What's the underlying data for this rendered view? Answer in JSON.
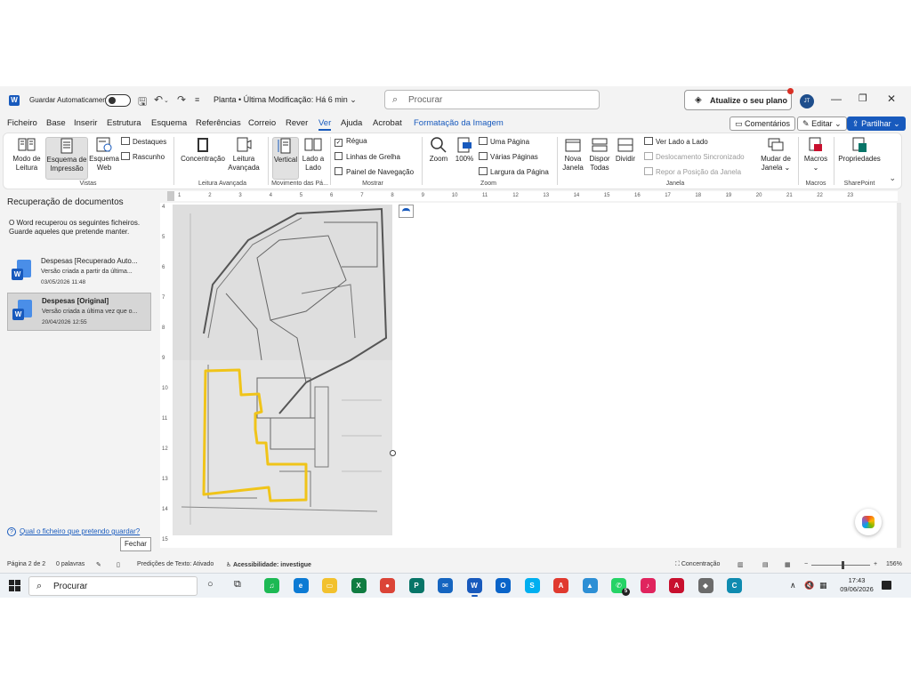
{
  "titlebar": {
    "autosave_label": "Guardar Automaticamente",
    "doc_title": "Planta • Última Modificação: Há 6 min",
    "search_placeholder": "Procurar",
    "upgrade_label": "Atualize o seu plano",
    "user_initials": "JT"
  },
  "menu": {
    "tabs": [
      "Ficheiro",
      "Base",
      "Inserir",
      "Estrutura",
      "Esquema",
      "Referências",
      "Correio",
      "Rever",
      "Ver",
      "Ajuda",
      "Acrobat",
      "Formatação da Imagem"
    ],
    "active_tab": "Ver",
    "comments_label": "Comentários",
    "edit_label": "Editar",
    "share_label": "Partilhar"
  },
  "ribbon": {
    "views": {
      "read_mode": "Modo de Leitura",
      "print_layout": "Esquema de Impressão",
      "web_layout": "Esquema Web",
      "outline": "Destaques",
      "draft": "Rascunho",
      "group_label": "Vistas"
    },
    "immersive": {
      "focus": "Concentração",
      "immersive_reader": "Leitura Avançada",
      "group_label": "Leitura Avançada"
    },
    "page_movement": {
      "vertical": "Vertical",
      "side_to_side": "Lado a Lado",
      "group_label": "Movimento das Pá..."
    },
    "show": {
      "ruler": "Régua",
      "gridlines": "Linhas de Grelha",
      "nav_pane": "Painel de Navegação",
      "ruler_checked": true,
      "gridlines_checked": false,
      "nav_pane_checked": false,
      "group_label": "Mostrar"
    },
    "zoom": {
      "zoom": "Zoom",
      "hundred": "100%",
      "one_page": "Uma Página",
      "multiple_pages": "Várias Páginas",
      "page_width": "Largura da Página",
      "group_label": "Zoom"
    },
    "window": {
      "new_window": "Nova Janela",
      "arrange_all": "Dispor Todas",
      "split": "Dividir",
      "side_by_side": "Ver Lado a Lado",
      "sync_scroll": "Deslocamento Sincronizado",
      "reset_position": "Repor a Posição da Janela",
      "switch_windows": "Mudar de Janela",
      "group_label": "Janela"
    },
    "macros": {
      "label": "Macros",
      "group_label": "Macros"
    },
    "sharepoint": {
      "label": "Propriedades",
      "group_label": "SharePoint"
    }
  },
  "recovery": {
    "title": "Recuperação de documentos",
    "message": "O Word recuperou os seguintes ficheiros. Guarde aqueles que pretende manter.",
    "items": [
      {
        "name": "Despesas  [Recuperado Auto...",
        "desc": "Versão criada a partir da última...",
        "date": "03/05/2026 11:48",
        "selected": false
      },
      {
        "name": "Despesas  [Original]",
        "desc": "Versão criada a última vez que o...",
        "date": "20/04/2026 12:55",
        "selected": true
      }
    ],
    "help_link": "Qual o ficheiro que pretendo guardar?",
    "close_label": "Fechar"
  },
  "ruler": {
    "h_ticks": [
      "1",
      "2",
      "3",
      "4",
      "5",
      "6",
      "7",
      "8",
      "9",
      "10",
      "11",
      "12",
      "13",
      "14",
      "15",
      "16",
      "17",
      "18",
      "19",
      "20",
      "21",
      "22",
      "23"
    ],
    "v_ticks": [
      "4",
      "5",
      "6",
      "7",
      "8",
      "9",
      "10",
      "11",
      "12",
      "13",
      "14",
      "15"
    ]
  },
  "status": {
    "page": "Página 2 de 2",
    "words": "0 palavras",
    "predictions": "Predições de Texto: Ativado",
    "accessibility": "Acessibilidade: investigue",
    "focus": "Concentração",
    "zoom_pct": "156%"
  },
  "taskbar": {
    "search_label": "Procurar",
    "apps": [
      {
        "name": "spotify-icon",
        "color": "#1db954",
        "glyph": "♫"
      },
      {
        "name": "edge-icon",
        "color": "#0c7bd4",
        "glyph": "e"
      },
      {
        "name": "file-explorer-icon",
        "color": "#f2c12e",
        "glyph": "▭"
      },
      {
        "name": "excel-icon",
        "color": "#107c41",
        "glyph": "X"
      },
      {
        "name": "chrome-icon",
        "color": "#db4437",
        "glyph": "●"
      },
      {
        "name": "publisher-icon",
        "color": "#077568",
        "glyph": "P"
      },
      {
        "name": "outlook-mail-icon",
        "color": "#1565c0",
        "glyph": "✉"
      },
      {
        "name": "word-icon",
        "color": "#185abd",
        "glyph": "W"
      },
      {
        "name": "outlook-icon",
        "color": "#0a64c9",
        "glyph": "O"
      },
      {
        "name": "skype-icon",
        "color": "#00aff0",
        "glyph": "S"
      },
      {
        "name": "acrobat-reader-icon",
        "color": "#e03a2f",
        "glyph": "A"
      },
      {
        "name": "photos-icon",
        "color": "#2d8fd5",
        "glyph": "▲"
      },
      {
        "name": "whatsapp-icon",
        "color": "#25d366",
        "glyph": "✆"
      },
      {
        "name": "tiktok-icon",
        "color": "#e0245e",
        "glyph": "♪"
      },
      {
        "name": "acrobat-icon",
        "color": "#c8102e",
        "glyph": "A"
      },
      {
        "name": "app-icon",
        "color": "#6b6b6b",
        "glyph": "◆"
      },
      {
        "name": "settings-app-icon",
        "color": "#0f8bb0",
        "glyph": "C"
      }
    ],
    "whatsapp_badge": "5",
    "time": "17:43",
    "date": "09/06/2026"
  }
}
